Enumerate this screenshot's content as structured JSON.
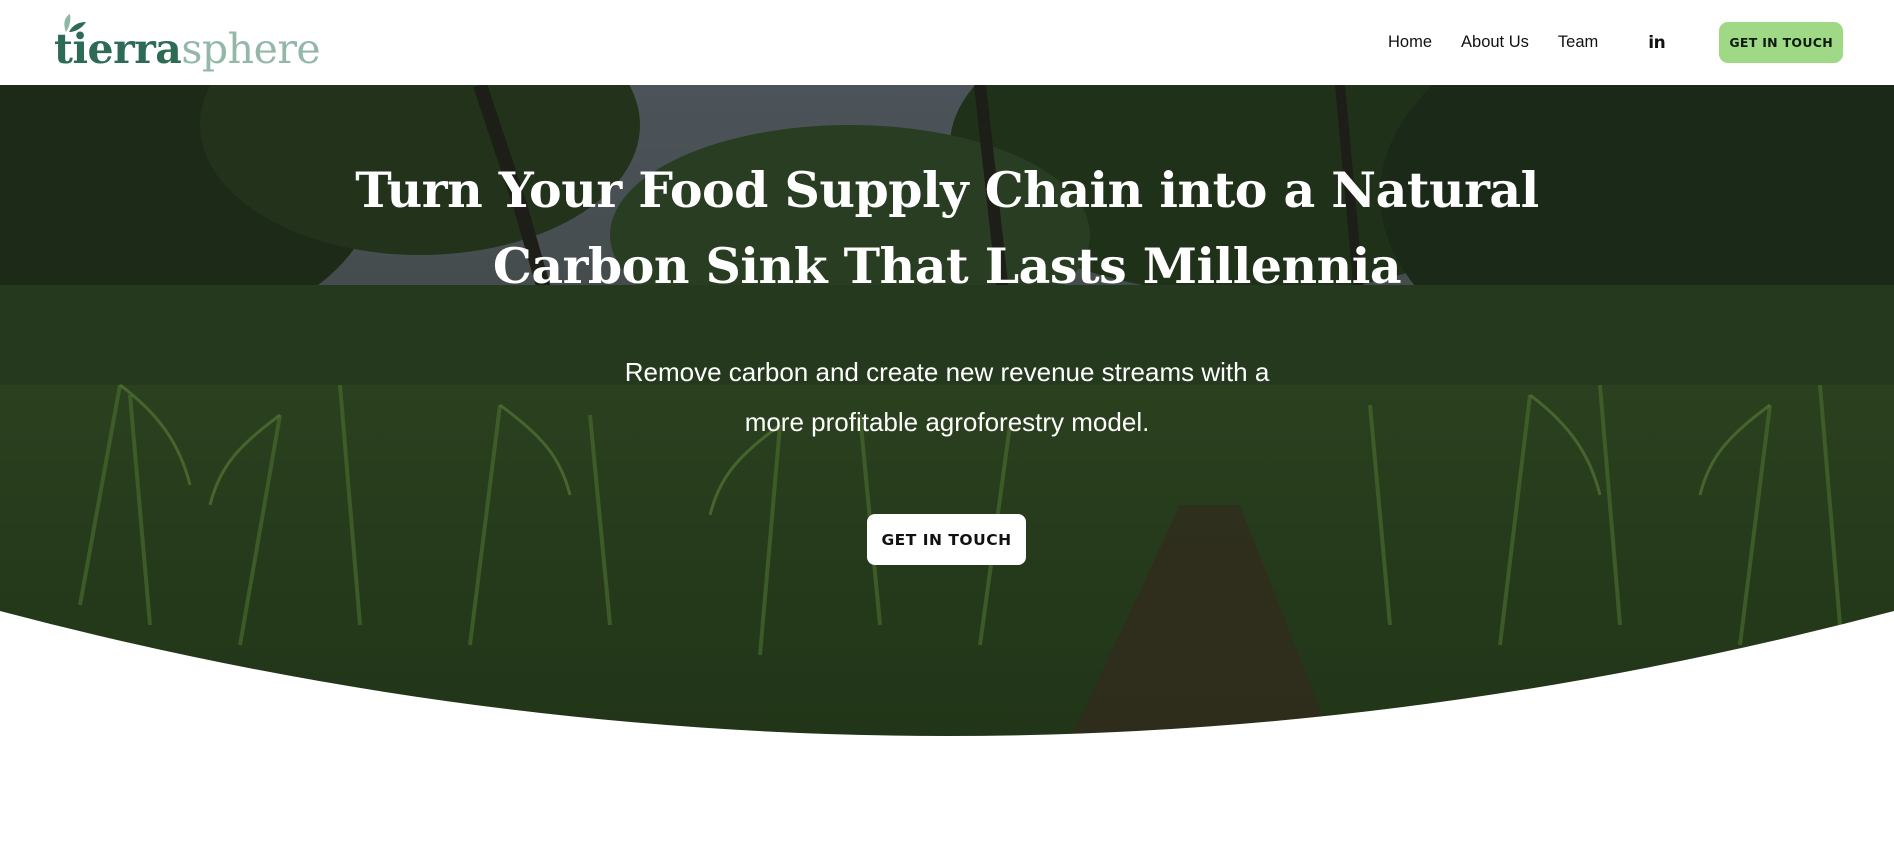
{
  "brand": {
    "name_part_1": "tierra",
    "name_part_2": "sphere"
  },
  "nav": {
    "items": [
      {
        "label": "Home"
      },
      {
        "label": "About Us"
      },
      {
        "label": "Team"
      }
    ],
    "social_label": "in",
    "social_icon": "linkedin-icon",
    "cta_label": "GET IN TOUCH"
  },
  "hero": {
    "title_line_1": "Turn Your Food Supply Chain into a Natural",
    "title_line_2": "Carbon Sink That Lasts Millennia",
    "subtitle_line_1": "Remove carbon and create new revenue streams with a",
    "subtitle_line_2": "more profitable agroforestry model.",
    "cta_label": "GET IN TOUCH"
  },
  "colors": {
    "brand_dark": "#2e6b55",
    "brand_light": "#93b8a8",
    "cta_green": "#9fd985",
    "foliage": "#3f6b2a"
  }
}
